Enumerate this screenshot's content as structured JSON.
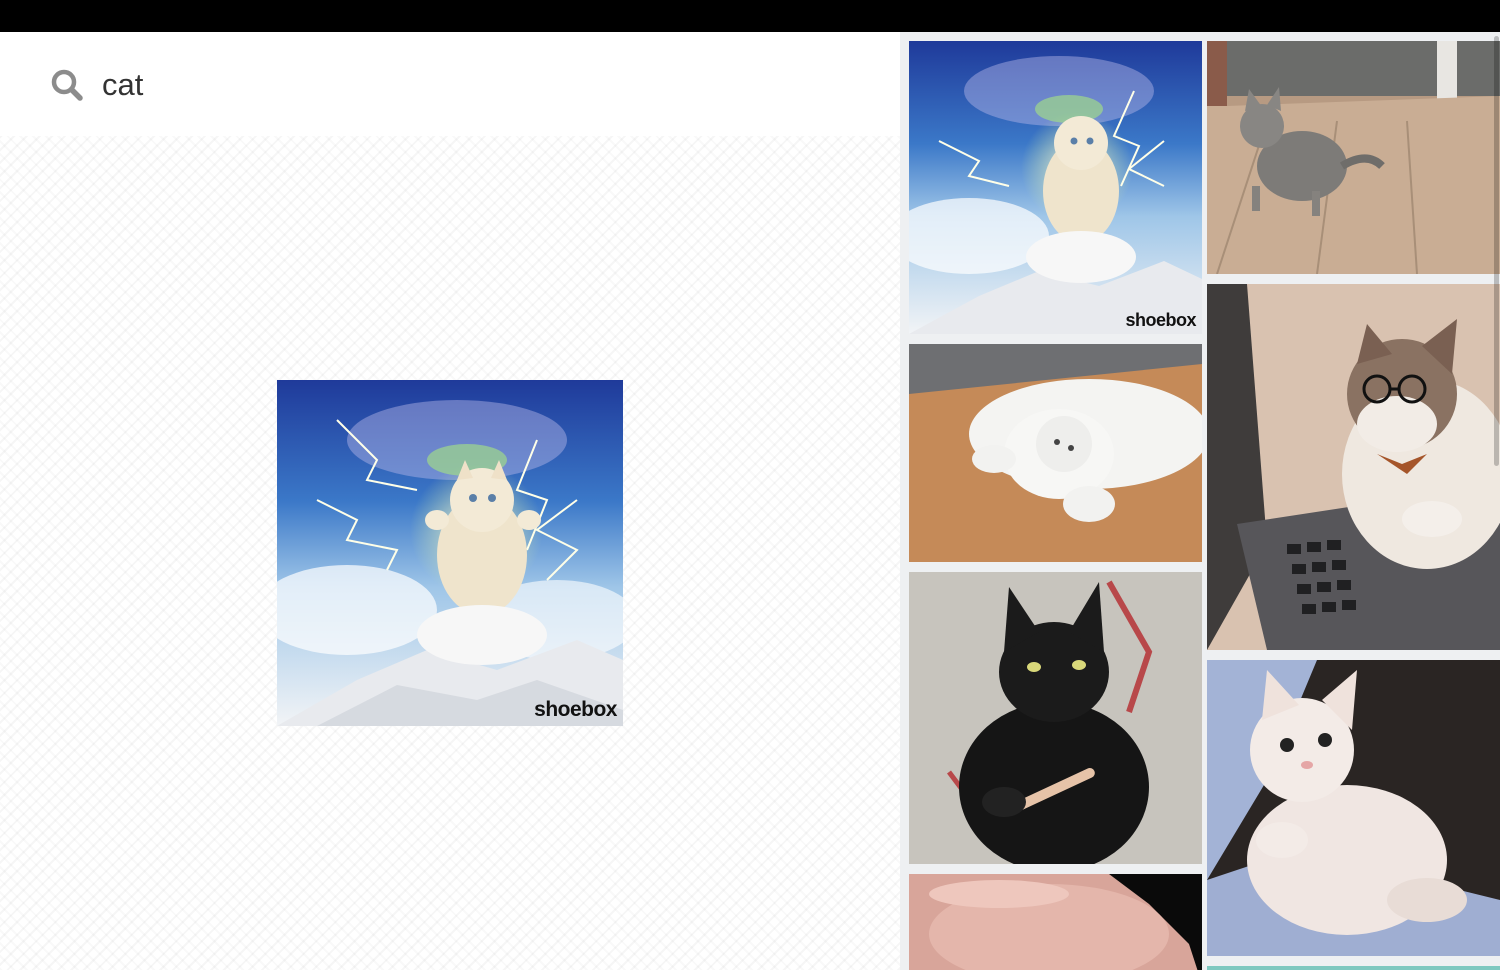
{
  "search": {
    "query": "cat",
    "icon": "search-icon"
  },
  "preview": {
    "watermark": "shoebox",
    "description_icon": "lightning-cat-gif"
  },
  "results": {
    "items": [
      {
        "kind": "lightning-cat",
        "watermark": "shoebox"
      },
      {
        "kind": "white-cat-rolling"
      },
      {
        "kind": "black-cat-nail-file"
      },
      {
        "kind": "pink-blob"
      },
      {
        "kind": "tabby-kitten-wood-floor"
      },
      {
        "kind": "cat-glasses-laptop"
      },
      {
        "kind": "kitten-lying"
      }
    ]
  },
  "colors": {
    "topbar": "#000000",
    "results_bg": "#eef0f2",
    "search_icon": "#8c8c8c"
  }
}
